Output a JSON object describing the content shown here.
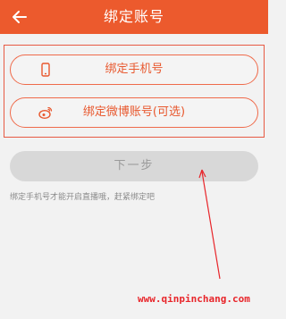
{
  "header": {
    "title": "绑定账号",
    "back_icon": "arrow-left-icon",
    "background_color": "#ec5a2d"
  },
  "options": [
    {
      "label": "绑定手机号",
      "icon": "phone-icon"
    },
    {
      "label": "绑定微博账号(可选)",
      "icon": "weibo-icon"
    }
  ],
  "next_button": {
    "label": "下一步",
    "state": "disabled"
  },
  "hint": "绑定手机号才能开启直播哦，赶紧绑定吧",
  "watermark": "www.qinpinchang.com",
  "accent_color": "#e8582e"
}
